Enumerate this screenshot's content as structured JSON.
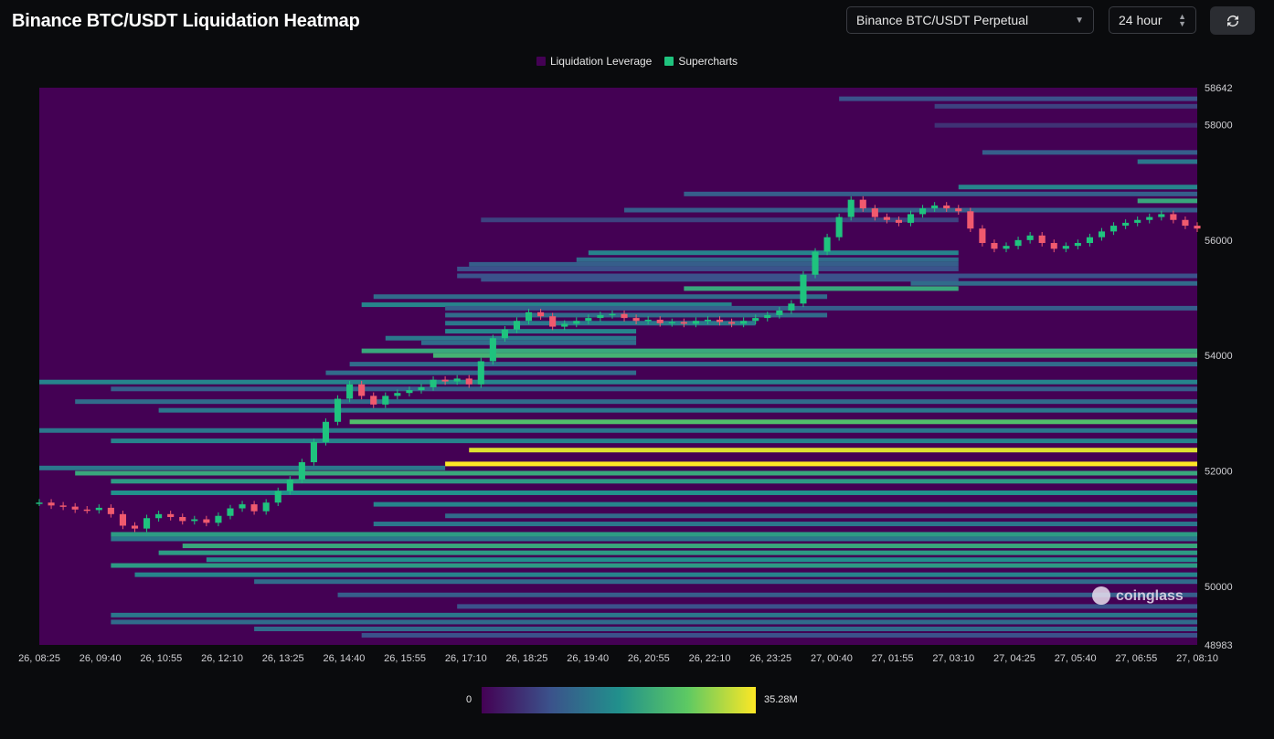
{
  "header": {
    "title": "Binance BTC/USDT Liquidation Heatmap",
    "market_select": "Binance BTC/USDT Perpetual",
    "range_select": "24 hour",
    "refresh_icon": "refresh-icon"
  },
  "legend": {
    "items": [
      {
        "label": "Liquidation Leverage",
        "color": "#440154"
      },
      {
        "label": "Supercharts",
        "color": "#1fc37e"
      }
    ]
  },
  "colorbar": {
    "min_label": "0",
    "max_label": "35.28M"
  },
  "watermark": "coinglass",
  "colors": {
    "background": "#0a0b0d",
    "heatmap_base": "#440154",
    "candle_up": "#1fc37e",
    "candle_down": "#f05a6e"
  },
  "chart_data": {
    "type": "heatmap",
    "title": "Binance BTC/USDT Liquidation Heatmap",
    "xlabel": "",
    "ylabel": "",
    "x_ticks": [
      "26, 08:25",
      "26, 09:40",
      "26, 10:55",
      "26, 12:10",
      "26, 13:25",
      "26, 14:40",
      "26, 15:55",
      "26, 17:10",
      "26, 18:25",
      "26, 19:40",
      "26, 20:55",
      "26, 22:10",
      "26, 23:25",
      "27, 00:40",
      "27, 01:55",
      "27, 03:10",
      "27, 04:25",
      "27, 05:40",
      "27, 06:55",
      "27, 08:10"
    ],
    "y_ticks": [
      58642,
      58000,
      56000,
      54000,
      52000,
      50000,
      48983
    ],
    "ylim": [
      48983,
      58642
    ],
    "colorscale": {
      "min": 0,
      "max": 35280000,
      "min_label": "0",
      "max_label": "35.28M"
    },
    "price_series": [
      [
        0,
        51450
      ],
      [
        1,
        51400
      ],
      [
        2,
        51380
      ],
      [
        3,
        51330
      ],
      [
        4,
        51320
      ],
      [
        5,
        51360
      ],
      [
        6,
        51250
      ],
      [
        7,
        51050
      ],
      [
        8,
        51000
      ],
      [
        9,
        51180
      ],
      [
        10,
        51250
      ],
      [
        11,
        51200
      ],
      [
        12,
        51130
      ],
      [
        13,
        51160
      ],
      [
        14,
        51100
      ],
      [
        15,
        51220
      ],
      [
        16,
        51350
      ],
      [
        17,
        51420
      ],
      [
        18,
        51300
      ],
      [
        19,
        51450
      ],
      [
        20,
        51650
      ],
      [
        21,
        51850
      ],
      [
        22,
        52150
      ],
      [
        23,
        52500
      ],
      [
        24,
        52850
      ],
      [
        25,
        53250
      ],
      [
        26,
        53500
      ],
      [
        27,
        53300
      ],
      [
        28,
        53150
      ],
      [
        29,
        53300
      ],
      [
        30,
        53350
      ],
      [
        31,
        53400
      ],
      [
        32,
        53450
      ],
      [
        33,
        53580
      ],
      [
        34,
        53550
      ],
      [
        35,
        53600
      ],
      [
        36,
        53500
      ],
      [
        37,
        53900
      ],
      [
        38,
        54300
      ],
      [
        39,
        54450
      ],
      [
        40,
        54600
      ],
      [
        41,
        54750
      ],
      [
        42,
        54680
      ],
      [
        43,
        54500
      ],
      [
        44,
        54550
      ],
      [
        45,
        54600
      ],
      [
        46,
        54650
      ],
      [
        47,
        54700
      ],
      [
        48,
        54720
      ],
      [
        49,
        54650
      ],
      [
        50,
        54600
      ],
      [
        51,
        54620
      ],
      [
        52,
        54560
      ],
      [
        53,
        54580
      ],
      [
        54,
        54550
      ],
      [
        55,
        54600
      ],
      [
        56,
        54620
      ],
      [
        57,
        54580
      ],
      [
        58,
        54550
      ],
      [
        59,
        54600
      ],
      [
        60,
        54650
      ],
      [
        61,
        54700
      ],
      [
        62,
        54780
      ],
      [
        63,
        54900
      ],
      [
        64,
        55400
      ],
      [
        65,
        55800
      ],
      [
        66,
        56050
      ],
      [
        67,
        56400
      ],
      [
        68,
        56700
      ],
      [
        69,
        56550
      ],
      [
        70,
        56400
      ],
      [
        71,
        56350
      ],
      [
        72,
        56300
      ],
      [
        73,
        56450
      ],
      [
        74,
        56550
      ],
      [
        75,
        56600
      ],
      [
        76,
        56550
      ],
      [
        77,
        56500
      ],
      [
        78,
        56200
      ],
      [
        79,
        55950
      ],
      [
        80,
        55850
      ],
      [
        81,
        55900
      ],
      [
        82,
        56000
      ],
      [
        83,
        56080
      ],
      [
        84,
        55950
      ],
      [
        85,
        55850
      ],
      [
        86,
        55900
      ],
      [
        87,
        55950
      ],
      [
        88,
        56050
      ],
      [
        89,
        56150
      ],
      [
        90,
        56250
      ],
      [
        91,
        56300
      ],
      [
        92,
        56350
      ],
      [
        93,
        56400
      ],
      [
        94,
        56450
      ],
      [
        95,
        56350
      ],
      [
        96,
        56250
      ],
      [
        97,
        56200
      ]
    ],
    "liquidation_levels": [
      [
        58450,
        67,
        97,
        0.25
      ],
      [
        58320,
        75,
        97,
        0.2
      ],
      [
        57990,
        75,
        97,
        0.15
      ],
      [
        57520,
        79,
        97,
        0.3
      ],
      [
        57360,
        92,
        97,
        0.4
      ],
      [
        56920,
        77,
        97,
        0.45
      ],
      [
        56800,
        54,
        97,
        0.3
      ],
      [
        56680,
        92,
        97,
        0.6
      ],
      [
        56520,
        49,
        97,
        0.3
      ],
      [
        56350,
        37,
        77,
        0.2
      ],
      [
        55780,
        46,
        77,
        0.45
      ],
      [
        55660,
        45,
        77,
        0.35
      ],
      [
        55580,
        36,
        77,
        0.3
      ],
      [
        55500,
        35,
        77,
        0.25
      ],
      [
        55380,
        35,
        97,
        0.25
      ],
      [
        55320,
        37,
        77,
        0.25
      ],
      [
        55250,
        73,
        97,
        0.35
      ],
      [
        55160,
        54,
        77,
        0.6
      ],
      [
        55020,
        28,
        66,
        0.35
      ],
      [
        54880,
        27,
        58,
        0.45
      ],
      [
        54820,
        34,
        97,
        0.3
      ],
      [
        54700,
        34,
        66,
        0.35
      ],
      [
        54560,
        34,
        60,
        0.4
      ],
      [
        54420,
        34,
        50,
        0.45
      ],
      [
        54300,
        29,
        50,
        0.4
      ],
      [
        54220,
        32,
        50,
        0.35
      ],
      [
        54080,
        27,
        97,
        0.6
      ],
      [
        54000,
        33,
        97,
        0.65
      ],
      [
        53850,
        26,
        97,
        0.35
      ],
      [
        53700,
        24,
        50,
        0.35
      ],
      [
        53540,
        0,
        97,
        0.45
      ],
      [
        53420,
        6,
        97,
        0.3
      ],
      [
        53200,
        3,
        97,
        0.35
      ],
      [
        53050,
        10,
        97,
        0.4
      ],
      [
        52850,
        26,
        97,
        0.7
      ],
      [
        52700,
        0,
        97,
        0.4
      ],
      [
        52520,
        6,
        97,
        0.45
      ],
      [
        52360,
        36,
        97,
        0.95
      ],
      [
        52120,
        34,
        97,
        1.0
      ],
      [
        52050,
        0,
        34,
        0.4
      ],
      [
        51960,
        3,
        97,
        0.6
      ],
      [
        51820,
        6,
        97,
        0.55
      ],
      [
        51620,
        6,
        97,
        0.5
      ],
      [
        51420,
        28,
        97,
        0.45
      ],
      [
        51220,
        34,
        97,
        0.35
      ],
      [
        51080,
        28,
        97,
        0.4
      ],
      [
        50900,
        6,
        97,
        0.55
      ],
      [
        50820,
        6,
        97,
        0.4
      ],
      [
        50700,
        12,
        97,
        0.6
      ],
      [
        50580,
        10,
        97,
        0.55
      ],
      [
        50460,
        14,
        97,
        0.5
      ],
      [
        50360,
        6,
        97,
        0.55
      ],
      [
        50200,
        8,
        97,
        0.45
      ],
      [
        50080,
        18,
        97,
        0.35
      ],
      [
        49850,
        25,
        97,
        0.3
      ],
      [
        49650,
        35,
        97,
        0.25
      ],
      [
        49500,
        6,
        97,
        0.4
      ],
      [
        49380,
        6,
        97,
        0.35
      ],
      [
        49260,
        18,
        97,
        0.35
      ],
      [
        49150,
        27,
        97,
        0.25
      ]
    ]
  }
}
